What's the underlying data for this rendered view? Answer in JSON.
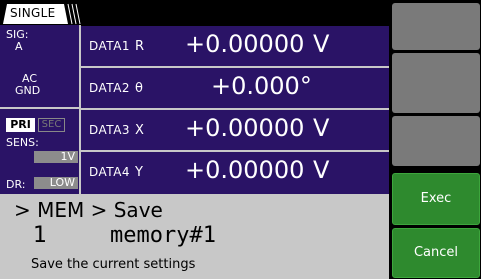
{
  "header": {
    "mode_tab": "SINGLE"
  },
  "status": {
    "sig_label": "SIG:",
    "sig_value": "A",
    "coupling": "AC",
    "ground": "GND",
    "pri_label": "PRI",
    "sec_label": "SEC",
    "sens_label": "SENS:",
    "sens_value": "1V",
    "dr_label": "DR:",
    "dr_value": "LOW"
  },
  "data_rows": [
    {
      "label": "DATA1",
      "var": "R",
      "value": "+0.00000",
      "unit": "V"
    },
    {
      "label": "DATA2",
      "var": "θ",
      "value": "+0.000°",
      "unit": ""
    },
    {
      "label": "DATA3",
      "var": "X",
      "value": "+0.00000",
      "unit": "V"
    },
    {
      "label": "DATA4",
      "var": "Y",
      "value": "+0.00000",
      "unit": "V"
    }
  ],
  "menu": {
    "path": "> MEM > Save",
    "memory_number": "1",
    "memory_name": "memory#1",
    "description": "Save the current settings"
  },
  "softkeys": [
    {
      "label": "",
      "state": "disabled"
    },
    {
      "label": "",
      "state": "disabled"
    },
    {
      "label": "",
      "state": "disabled"
    },
    {
      "label": "",
      "state": "disabled"
    },
    {
      "label": "Exec",
      "state": "active"
    },
    {
      "label": "Cancel",
      "state": "active"
    }
  ],
  "colors": {
    "panel": "#2a1366",
    "divider": "#c8c8c8",
    "softkey_active": "#2e8a2e",
    "softkey_disabled": "#7a7a7a"
  }
}
